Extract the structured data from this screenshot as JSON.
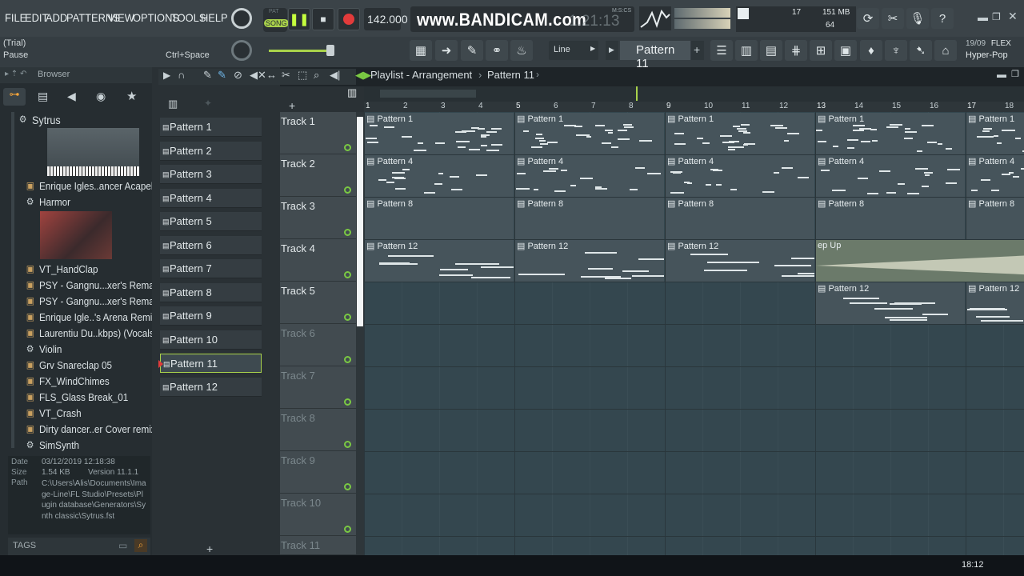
{
  "menu": [
    "FILE",
    "EDIT",
    "ADD",
    "PATTERNS",
    "VIEW",
    "OPTIONS",
    "TOOLS",
    "HELP"
  ],
  "transport": {
    "mode": "SONG",
    "pat_label": "PAT",
    "tempo": "142.000"
  },
  "watermark": "www.BANDICAM.com",
  "time": {
    "value": "1:21:13",
    "unit": "M:S:CS"
  },
  "cpu": {
    "voices": "17",
    "memory": "151 MB",
    "poly": "64"
  },
  "hint": {
    "line1": "(Trial)",
    "line2": "Pause",
    "shortcut": "Ctrl+Space"
  },
  "snap": "Line",
  "current_pattern": "Pattern 11",
  "news": {
    "date": "19/09",
    "tag": "FLEX",
    "title": "Hyper-Pop"
  },
  "browser": {
    "title": "Browser",
    "items": [
      {
        "label": "Sytrus",
        "icon": "plugin-icon"
      },
      {
        "label": "Enrique Igles..ancer Acapella",
        "icon": "audio-file-icon"
      },
      {
        "label": "Harmor",
        "icon": "plugin-icon"
      },
      {
        "label": "VT_HandClap",
        "icon": "audio-file-icon"
      },
      {
        "label": "PSY - Gangnu...xer's Remake)",
        "icon": "audio-file-icon"
      },
      {
        "label": "PSY - Gangnu...xer's Remake)",
        "icon": "audio-file-icon"
      },
      {
        "label": "Enrique Igle..'s Arena Remix)",
        "icon": "audio-file-icon"
      },
      {
        "label": "Laurentiu Du..kbps) (Vocals)",
        "icon": "audio-file-icon"
      },
      {
        "label": "Violin",
        "icon": "plugin-icon"
      },
      {
        "label": "Grv Snareclap 05",
        "icon": "audio-file-icon"
      },
      {
        "label": "FX_WindChimes",
        "icon": "audio-file-icon"
      },
      {
        "label": "FLS_Glass Break_01",
        "icon": "audio-file-icon"
      },
      {
        "label": "VT_Crash",
        "icon": "audio-file-icon"
      },
      {
        "label": "Dirty dancer..er  Cover remix",
        "icon": "audio-file-icon"
      },
      {
        "label": "SimSynth",
        "icon": "plugin-icon"
      }
    ],
    "info": {
      "date_label": "Date",
      "date": "03/12/2019 12:18:38",
      "size_label": "Size",
      "size": "1.54 KB",
      "version": "Version 11.1.1",
      "path_label": "Path",
      "path": "C:\\Users\\Alis\\Documents\\Image-Line\\FL Studio\\Presets\\Plugin database\\Generators\\Synth classic\\Sytrus.fst"
    },
    "tags": "TAGS"
  },
  "patterns": [
    "Pattern 1",
    "Pattern 2",
    "Pattern 3",
    "Pattern 4",
    "Pattern 5",
    "Pattern 6",
    "Pattern 7",
    "Pattern 8",
    "Pattern 9",
    "Pattern 10",
    "Pattern 11",
    "Pattern 12"
  ],
  "playlist": {
    "title": "Playlist - Arrangement",
    "crumb": "Pattern 11",
    "ruler": [
      "1",
      "2",
      "3",
      "4",
      "5",
      "6",
      "7",
      "8",
      "9",
      "10",
      "11",
      "12",
      "13",
      "14",
      "15",
      "16",
      "17",
      "18"
    ],
    "tracks": [
      "Track 1",
      "Track 2",
      "Track 3",
      "Track 4",
      "Track 5",
      "Track 6",
      "Track 7",
      "Track 8",
      "Track 9",
      "Track 10",
      "Track 11"
    ],
    "clip_labels": [
      "Pattern 1",
      "Pattern 4",
      "Pattern 8",
      "Pattern 12"
    ],
    "sweep_label": "ep Up"
  },
  "clock": "18:12",
  "colors": {
    "accent_green": "#7ac943",
    "clip": "#46545b",
    "playlist_bg": "#34474f"
  }
}
